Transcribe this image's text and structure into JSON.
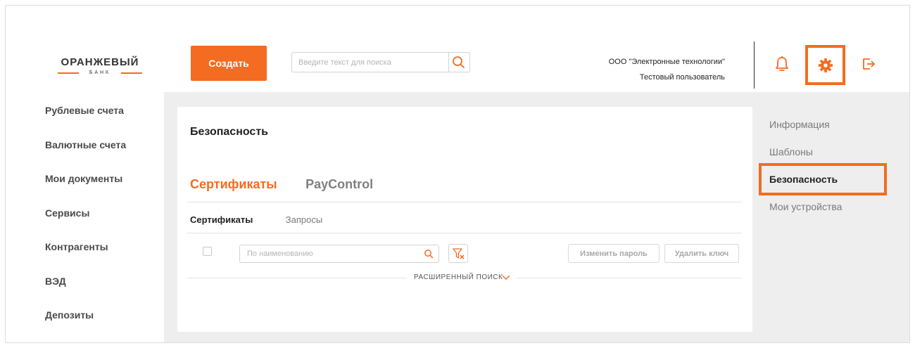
{
  "brand": {
    "name": "ОРАНЖЕВЫЙ",
    "subname": "БАНК",
    "accent": "#f36c21"
  },
  "header": {
    "create_label": "Создать",
    "search_placeholder": "Введите текст для поиска",
    "org_name": "ООО \"Электронные технологии\"",
    "user_name": "Тестовый пользователь"
  },
  "nav": {
    "items": [
      {
        "label": "Рублевые счета"
      },
      {
        "label": "Валютные счета"
      },
      {
        "label": "Мои документы"
      },
      {
        "label": "Сервисы"
      },
      {
        "label": "Контрагенты"
      },
      {
        "label": "ВЭД"
      },
      {
        "label": "Депозиты"
      }
    ]
  },
  "main": {
    "title": "Безопасность",
    "tabs": [
      {
        "label": "Сертификаты",
        "active": true
      },
      {
        "label": "PayControl",
        "active": false
      }
    ],
    "subtabs": [
      {
        "label": "Сертификаты",
        "active": true
      },
      {
        "label": "Запросы",
        "active": false
      }
    ],
    "filter_placeholder": "По наименованию",
    "change_password_label": "Изменить пароль",
    "delete_key_label": "Удалить ключ",
    "advanced_search_label": "РАСШИРЕННЫЙ ПОИСК"
  },
  "settings_menu": {
    "items": [
      {
        "label": "Информация",
        "active": false
      },
      {
        "label": "Шаблоны",
        "active": false
      },
      {
        "label": "Безопасность",
        "active": true
      },
      {
        "label": "Мои устройства",
        "active": false
      }
    ]
  },
  "icons": [
    "search-icon",
    "bell-icon",
    "gear-icon",
    "logout-icon",
    "filter-clear-icon",
    "chevron-down-icon"
  ]
}
